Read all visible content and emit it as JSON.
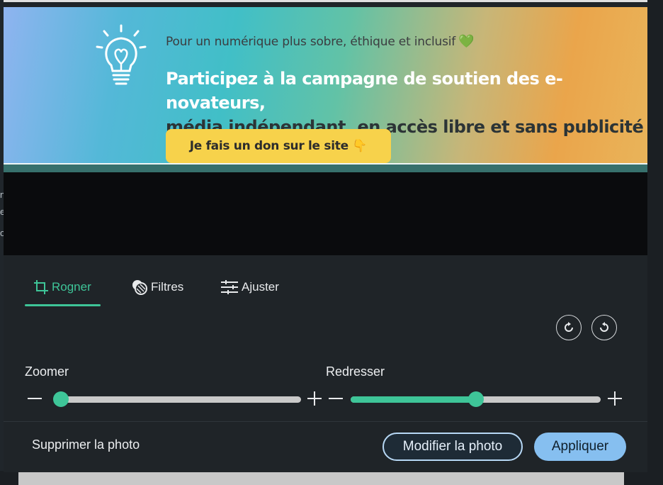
{
  "banner": {
    "tagline": "Pour un numérique plus sobre, éthique et inclusif",
    "heart_icon": "green-heart-icon",
    "headline_line1": "Participez à la campagne de soutien des e-novateurs,",
    "headline_line2": "média indépendant, en accès libre et sans publicité !",
    "donate_label": "Je fais un don sur le site 👇",
    "accent_color": "#f7d24b"
  },
  "editor": {
    "tabs": [
      {
        "label": "Rogner",
        "icon": "crop-icon",
        "active": true
      },
      {
        "label": "Filtres",
        "icon": "filters-icon",
        "active": false
      },
      {
        "label": "Ajuster",
        "icon": "sliders-icon",
        "active": false
      }
    ],
    "rotate_right_icon": "rotate-clockwise-icon",
    "rotate_left_icon": "rotate-counterclockwise-icon",
    "zoom": {
      "label": "Zoomer",
      "value": 0.0
    },
    "straighten": {
      "label": "Redresser",
      "value": 0.5
    },
    "accent_color": "#3ec598"
  },
  "footer": {
    "delete_label": "Supprimer la photo",
    "modify_label": "Modifier la photo",
    "apply_label": "Appliquer"
  },
  "background_page": {
    "left_edge_chars": [
      "n",
      "e",
      "o"
    ]
  }
}
